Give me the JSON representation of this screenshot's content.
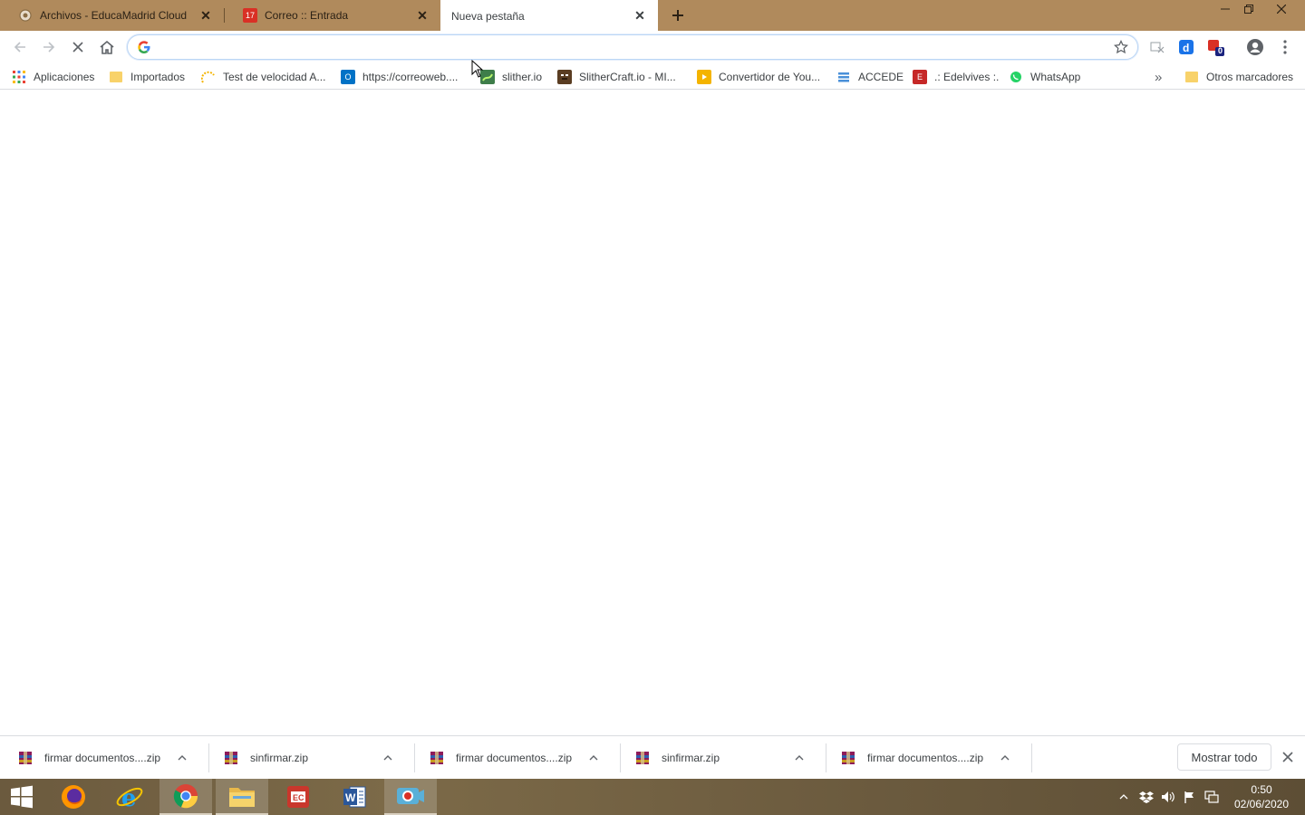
{
  "tabs": [
    {
      "title": "Archivos - EducaMadrid Cloud",
      "icon": "educamadrid-cloud-icon"
    },
    {
      "title": "Correo :: Entrada",
      "icon": "mail-calendar-icon"
    },
    {
      "title": "Nueva pestaña",
      "icon": "none",
      "active": true
    }
  ],
  "omnibox": {
    "value": "",
    "placeholder": ""
  },
  "bookmarks": [
    {
      "label": "Aplicaciones",
      "icon": "apps-grid-icon"
    },
    {
      "label": "Importados",
      "icon": "folder-icon"
    },
    {
      "label": "Test de velocidad A...",
      "icon": "speedtest-icon"
    },
    {
      "label": "https://correoweb....",
      "icon": "outlook-icon"
    },
    {
      "label": "slither.io",
      "icon": "slither-icon"
    },
    {
      "label": "SlitherCraft.io - MI...",
      "icon": "slithercraft-icon"
    },
    {
      "label": "Convertidor de You...",
      "icon": "youtube-converter-icon"
    },
    {
      "label": "ACCEDE",
      "icon": "accede-icon"
    },
    {
      "label": ".: Edelvives :.",
      "icon": "edelvives-icon"
    },
    {
      "label": "WhatsApp",
      "icon": "whatsapp-icon"
    }
  ],
  "bookmarks_more": "»",
  "other_bookmarks": "Otros marcadores",
  "extensions": {
    "badge": "0"
  },
  "downloads": [
    {
      "name": "firmar documentos....zip"
    },
    {
      "name": "sinfirmar.zip"
    },
    {
      "name": "firmar documentos....zip"
    },
    {
      "name": "sinfirmar.zip"
    },
    {
      "name": "firmar documentos....zip"
    }
  ],
  "show_all": "Mostrar todo",
  "taskbar": {
    "apps": [
      "start-icon",
      "firefox-icon",
      "internet-explorer-icon",
      "chrome-icon",
      "file-explorer-icon",
      "pdf-reader-icon",
      "word-icon",
      "screen-recorder-icon"
    ],
    "time": "0:50",
    "date": "02/06/2020"
  }
}
